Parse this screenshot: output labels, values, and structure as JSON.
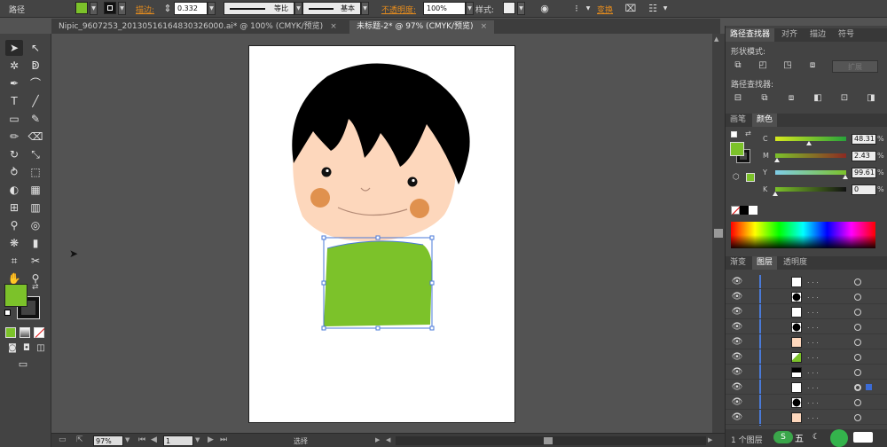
{
  "control_bar": {
    "object_type": "路径",
    "fill_color": "#7cc22a",
    "stroke_label": "描边:",
    "stroke_weight": "0.332",
    "stroke_profile": "等比",
    "brush": "基本",
    "opacity_label": "不透明度:",
    "opacity_value": "100%",
    "style_label": "样式:",
    "transform_label": "变换"
  },
  "tabs": [
    {
      "label": "Nipic_9607253_20130516164830326000.ai* @ 100% (CMYK/预览)",
      "close": "×",
      "active": false
    },
    {
      "label": "未标题-2* @ 97% (CMYK/预览)",
      "close": "×",
      "active": true
    }
  ],
  "tools": {
    "fill_color": "#7cc22a",
    "stroke_color": "#000000"
  },
  "status": {
    "zoom": "97%",
    "page": "1",
    "tool_name": "选择"
  },
  "pathfinder": {
    "tabs": [
      "路径查找器",
      "对齐",
      "描边",
      "符号"
    ],
    "shape_modes_label": "形状模式:",
    "expand_label": "扩展",
    "pathfinders_label": "路径查找器:"
  },
  "color_panel": {
    "tabs": [
      "画笔",
      "颜色"
    ],
    "channels": [
      {
        "name": "C",
        "value": "48.31",
        "unit": "%",
        "level": 0.48
      },
      {
        "name": "M",
        "value": "2.43",
        "unit": "%",
        "level": 0.02
      },
      {
        "name": "Y",
        "value": "99.61",
        "unit": "%",
        "level": 0.99
      },
      {
        "name": "K",
        "value": "0",
        "unit": "%",
        "level": 0.0
      }
    ]
  },
  "layers_panel": {
    "tabs": [
      "渐变",
      "图层",
      "透明度"
    ],
    "footer_label": "1 个图层"
  }
}
